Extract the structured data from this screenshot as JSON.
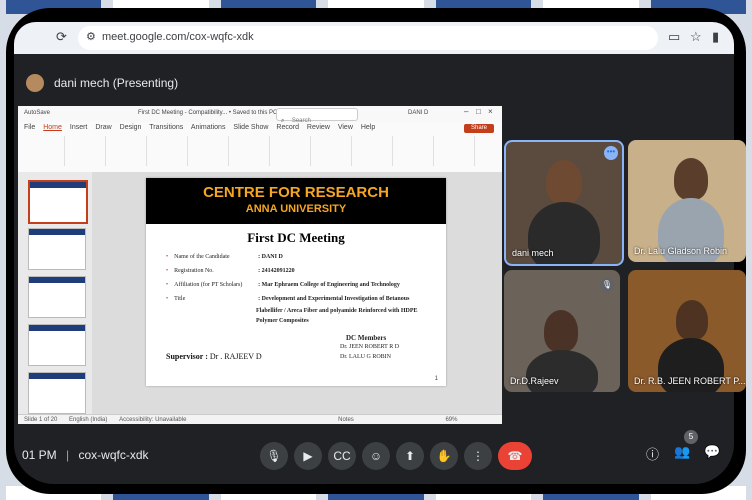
{
  "browser": {
    "url": "meet.google.com/cox-wqfc-xdk",
    "reload_icon": "reload-icon",
    "site_icon": "tune-icon"
  },
  "meet": {
    "presenter_label": "dani mech (Presenting)",
    "meeting_time": "01 PM",
    "meeting_code": "cox-wqfc-xdk",
    "participant_count": "5"
  },
  "ppt": {
    "autosave": "AutoSave",
    "file_title": "First DC Meeting - Compatibility... • Saved to this PC",
    "search_placeholder": "Search",
    "user": "DANI D",
    "tabs": [
      "File",
      "Home",
      "Insert",
      "Draw",
      "Design",
      "Transitions",
      "Animations",
      "Slide Show",
      "Record",
      "Review",
      "View",
      "Help"
    ],
    "share": "Share",
    "status_left": "Slide 1 of 20",
    "status_lang": "English (India)",
    "status_access": "Accessibility: Unavailable",
    "status_notes": "Notes",
    "status_zoom": "69%"
  },
  "slide": {
    "header_line1": "CENTRE FOR RESEARCH",
    "header_line2": "ANNA UNIVERSITY",
    "title": "First DC Meeting",
    "rows": [
      {
        "label": "Name of the Candidate",
        "value": ": DANI D"
      },
      {
        "label": "Registration No.",
        "value": ": 24142091220"
      },
      {
        "label": "Affiliation (for PT Scholars)",
        "value": ": Mar Ephraem College of Engineering and Technology"
      },
      {
        "label": "Title",
        "value": ": Development and Experimental Investigation of Betanous"
      }
    ],
    "title_cont1": "Flabellifer / Areca Fiber and polyamide Reinforced with HDPE",
    "title_cont2": "Polymer Composites",
    "dc_members_heading": "DC Members",
    "dc_members": [
      "Dr. JEEN ROBERT R D",
      "Dr. LALU G ROBIN"
    ],
    "supervisor_label": "Supervisor :",
    "supervisor_name": "Dr . RAJEEV D",
    "page_number": "1"
  },
  "participants": [
    {
      "name": "dani mech"
    },
    {
      "name": "Dr. Lalu Gladson Robin"
    },
    {
      "name": "Dr.D.Rajeev"
    },
    {
      "name": "Dr. R.B. JEEN ROBERT P..."
    }
  ],
  "colors": {
    "meet_bg": "#202124",
    "slide_accent": "#f5a623",
    "end_call": "#ea4335",
    "active_speaker": "#8ab4f8"
  }
}
